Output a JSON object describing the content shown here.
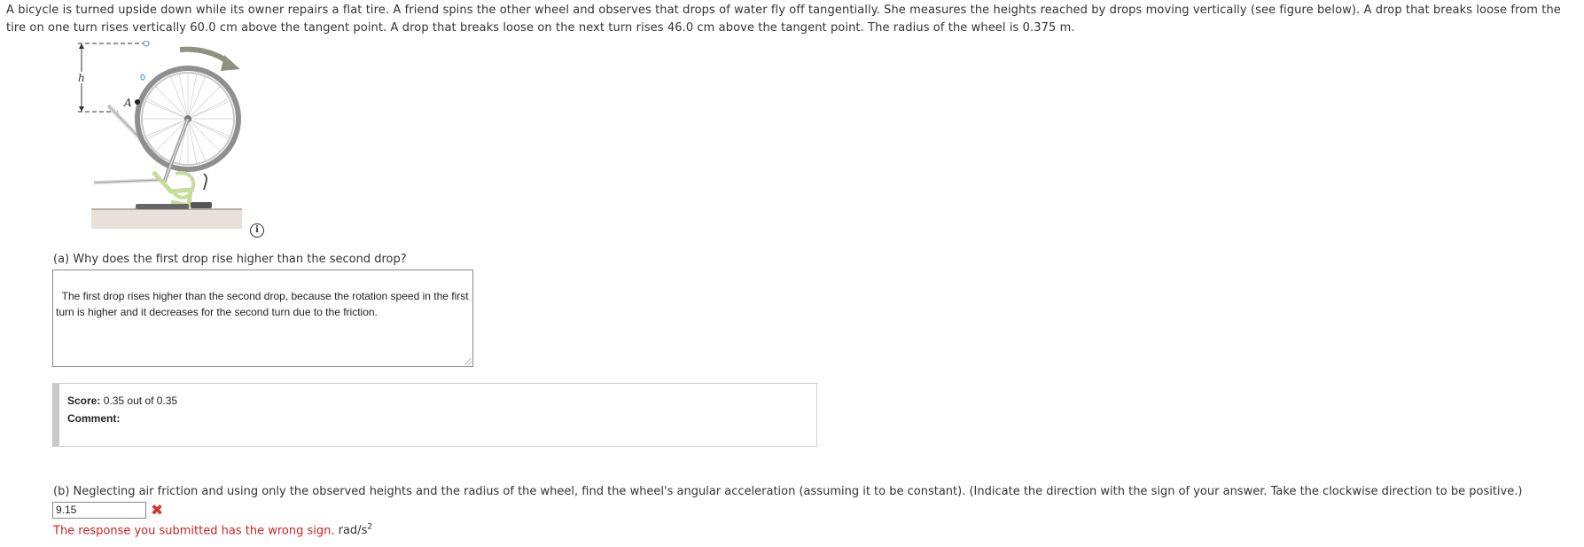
{
  "problem": {
    "text": "A bicycle is turned upside down while its owner repairs a flat tire. A friend spins the other wheel and observes that drops of water fly off tangentially. She measures the heights reached by drops moving vertically (see figure below). A drop that breaks loose from the tire on one turn rises vertically 60.0 cm above the tangent point. A drop that breaks loose on the next turn rises 46.0 cm above the tangent point. The radius of the wheel is 0.375 m."
  },
  "figure": {
    "label_h": "h",
    "label_a": "A"
  },
  "part_a": {
    "question": "(a) Why does the first drop rise higher than the second drop?",
    "answer": "The first drop rises higher than the second drop, because the rotation speed in the first turn is higher and it decreases for the second turn due to the friction."
  },
  "score": {
    "label": "Score:",
    "value": "0.35 out of 0.35",
    "comment_label": "Comment:"
  },
  "part_b": {
    "question": "(b) Neglecting air friction and using only the observed heights and the radius of the wheel, find the wheel's angular acceleration (assuming it to be constant). (Indicate the direction with the sign of your answer. Take the clockwise direction to be positive.)",
    "answer_value": "9.15",
    "status_icon": "wrong-x-icon",
    "feedback": "The response you submitted has the wrong sign.",
    "unit": "rad/s",
    "unit_exponent": "2"
  },
  "colors": {
    "error": "#cc2222",
    "wrong_icon": "#d9342b",
    "score_bar": "#c8c8c8",
    "frame_green": "#c8dc9a"
  }
}
